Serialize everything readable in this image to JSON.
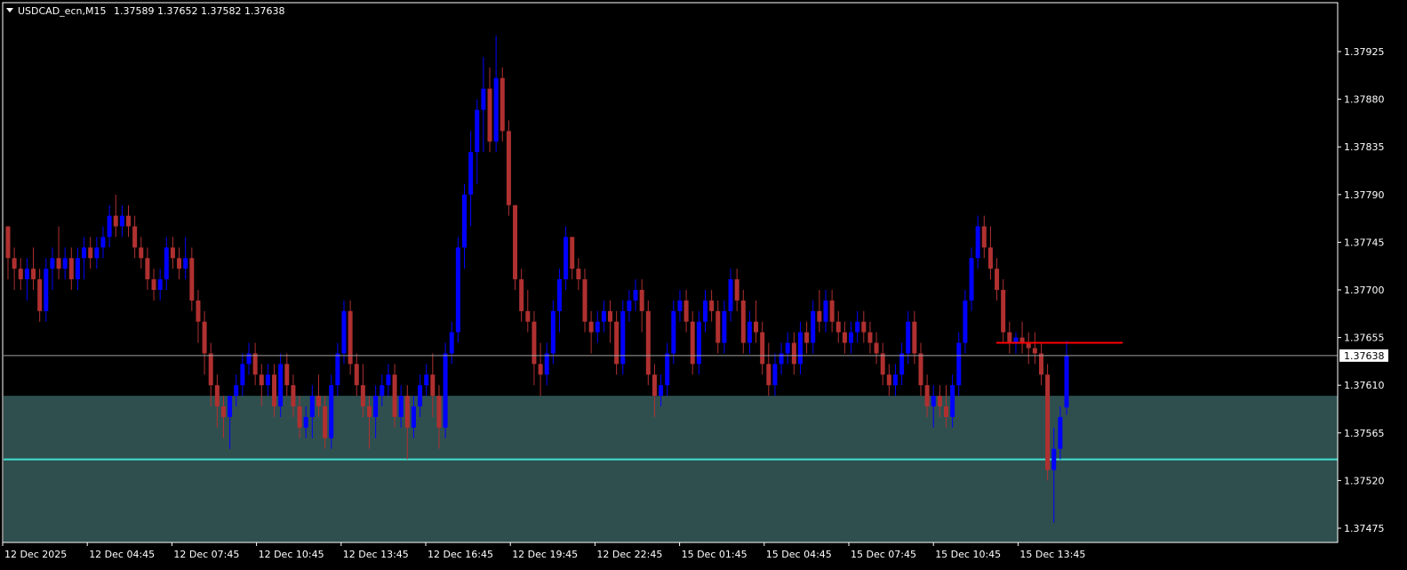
{
  "header": {
    "symbol_info": "USDCAD_ecn,M15",
    "ohlc": "1.37589 1.37652 1.37582 1.37638"
  },
  "colors": {
    "background": "#000000",
    "bull": "#0000FF",
    "bear": "#B03030",
    "grid_frame": "#FFFFFF",
    "zone_fill": "#2F4F4F",
    "zone_line": "#40E0D0",
    "resistance_line": "#FF0000",
    "bid_line": "#A0A0A0"
  },
  "chart_data": {
    "type": "candlestick",
    "y_ticks": [
      "1.37925",
      "1.37880",
      "1.37835",
      "1.37790",
      "1.37745",
      "1.37700",
      "1.37655",
      "1.37610",
      "1.37565",
      "1.37520",
      "1.37475"
    ],
    "ylim": [
      1.37445,
      1.3797
    ],
    "x_ticks": [
      "12 Dec 2025",
      "12 Dec 04:45",
      "12 Dec 07:45",
      "12 Dec 10:45",
      "12 Dec 13:45",
      "12 Dec 16:45",
      "12 Dec 19:45",
      "12 Dec 22:45",
      "15 Dec 01:45",
      "15 Dec 04:45",
      "15 Dec 07:45",
      "15 Dec 10:45",
      "15 Dec 13:45"
    ],
    "current_price": "1.37638",
    "zone": {
      "top": 1.376,
      "bottom": 1.3745
    },
    "zone_line": 1.3754,
    "resistance_line": 1.3765,
    "candles": [
      [
        1.3776,
        1.3776,
        1.3771,
        1.3773
      ],
      [
        1.3773,
        1.3774,
        1.377,
        1.3772
      ],
      [
        1.3772,
        1.3773,
        1.377,
        1.3771
      ],
      [
        1.3771,
        1.3773,
        1.3769,
        1.3772
      ],
      [
        1.3772,
        1.3774,
        1.377,
        1.3771
      ],
      [
        1.3771,
        1.3772,
        1.3767,
        1.3768
      ],
      [
        1.3768,
        1.3773,
        1.3767,
        1.3772
      ],
      [
        1.3772,
        1.3774,
        1.377,
        1.3773
      ],
      [
        1.3773,
        1.3776,
        1.3771,
        1.3772
      ],
      [
        1.3772,
        1.3774,
        1.3771,
        1.3773
      ],
      [
        1.3773,
        1.3774,
        1.377,
        1.3771
      ],
      [
        1.3771,
        1.3774,
        1.377,
        1.3773
      ],
      [
        1.3773,
        1.3775,
        1.3771,
        1.3774
      ],
      [
        1.3774,
        1.3775,
        1.3772,
        1.3773
      ],
      [
        1.3773,
        1.3775,
        1.3772,
        1.3774
      ],
      [
        1.3774,
        1.3776,
        1.3773,
        1.3775
      ],
      [
        1.3775,
        1.3778,
        1.3774,
        1.3777
      ],
      [
        1.3777,
        1.3779,
        1.3775,
        1.3776
      ],
      [
        1.3776,
        1.3778,
        1.3775,
        1.3777
      ],
      [
        1.3777,
        1.3778,
        1.3775,
        1.3776
      ],
      [
        1.3776,
        1.3777,
        1.3773,
        1.3774
      ],
      [
        1.3774,
        1.3775,
        1.3772,
        1.3773
      ],
      [
        1.3773,
        1.3774,
        1.377,
        1.3771
      ],
      [
        1.3771,
        1.3772,
        1.3769,
        1.377
      ],
      [
        1.377,
        1.3772,
        1.3769,
        1.3771
      ],
      [
        1.3771,
        1.3775,
        1.377,
        1.3774
      ],
      [
        1.3774,
        1.3775,
        1.3772,
        1.3773
      ],
      [
        1.3773,
        1.3774,
        1.3771,
        1.3772
      ],
      [
        1.3772,
        1.3775,
        1.3771,
        1.3773
      ],
      [
        1.3773,
        1.3774,
        1.3768,
        1.3769
      ],
      [
        1.3769,
        1.377,
        1.3765,
        1.3767
      ],
      [
        1.3767,
        1.3768,
        1.3762,
        1.3764
      ],
      [
        1.3764,
        1.3765,
        1.3759,
        1.3761
      ],
      [
        1.3761,
        1.3762,
        1.3757,
        1.3759
      ],
      [
        1.3759,
        1.376,
        1.3756,
        1.3758
      ],
      [
        1.3758,
        1.376,
        1.3755,
        1.376
      ],
      [
        1.376,
        1.3762,
        1.3759,
        1.3761
      ],
      [
        1.3761,
        1.3764,
        1.376,
        1.3763
      ],
      [
        1.3763,
        1.3765,
        1.3762,
        1.3764
      ],
      [
        1.3764,
        1.3765,
        1.3761,
        1.3762
      ],
      [
        1.3762,
        1.3763,
        1.3759,
        1.3761
      ],
      [
        1.3761,
        1.3763,
        1.376,
        1.3762
      ],
      [
        1.3762,
        1.3763,
        1.3758,
        1.3759
      ],
      [
        1.3759,
        1.3764,
        1.3758,
        1.3763
      ],
      [
        1.3763,
        1.3764,
        1.376,
        1.3761
      ],
      [
        1.3761,
        1.3762,
        1.3758,
        1.3759
      ],
      [
        1.3759,
        1.376,
        1.3756,
        1.3757
      ],
      [
        1.3757,
        1.3759,
        1.3756,
        1.3758
      ],
      [
        1.3758,
        1.3761,
        1.3756,
        1.376
      ],
      [
        1.376,
        1.3762,
        1.3758,
        1.3759
      ],
      [
        1.3759,
        1.376,
        1.3755,
        1.3756
      ],
      [
        1.3756,
        1.3762,
        1.3755,
        1.3761
      ],
      [
        1.3761,
        1.3765,
        1.376,
        1.3764
      ],
      [
        1.3764,
        1.3769,
        1.3763,
        1.3768
      ],
      [
        1.3768,
        1.3769,
        1.3762,
        1.3763
      ],
      [
        1.3763,
        1.3764,
        1.376,
        1.3761
      ],
      [
        1.3761,
        1.3763,
        1.3758,
        1.3759
      ],
      [
        1.3759,
        1.376,
        1.3755,
        1.3758
      ],
      [
        1.3758,
        1.3761,
        1.3756,
        1.376
      ],
      [
        1.376,
        1.3762,
        1.3759,
        1.3761
      ],
      [
        1.3761,
        1.3763,
        1.376,
        1.3762
      ],
      [
        1.3762,
        1.3763,
        1.3757,
        1.3758
      ],
      [
        1.3758,
        1.3761,
        1.3757,
        1.376
      ],
      [
        1.376,
        1.3761,
        1.3754,
        1.3757
      ],
      [
        1.3757,
        1.376,
        1.3756,
        1.3759
      ],
      [
        1.3759,
        1.3762,
        1.3758,
        1.3761
      ],
      [
        1.3761,
        1.3763,
        1.376,
        1.3762
      ],
      [
        1.3762,
        1.3764,
        1.3758,
        1.376
      ],
      [
        1.376,
        1.3761,
        1.3755,
        1.3757
      ],
      [
        1.3757,
        1.3765,
        1.3756,
        1.3764
      ],
      [
        1.3764,
        1.3767,
        1.3763,
        1.3766
      ],
      [
        1.3766,
        1.3775,
        1.3765,
        1.3774
      ],
      [
        1.3774,
        1.378,
        1.3772,
        1.3779
      ],
      [
        1.3779,
        1.3785,
        1.3776,
        1.3783
      ],
      [
        1.3783,
        1.3788,
        1.378,
        1.3787
      ],
      [
        1.3787,
        1.3792,
        1.3783,
        1.3789
      ],
      [
        1.3789,
        1.3791,
        1.3783,
        1.3784
      ],
      [
        1.3784,
        1.3794,
        1.3783,
        1.379
      ],
      [
        1.379,
        1.3791,
        1.3784,
        1.3785
      ],
      [
        1.3785,
        1.3786,
        1.3777,
        1.3778
      ],
      [
        1.3778,
        1.3778,
        1.377,
        1.3771
      ],
      [
        1.3771,
        1.3772,
        1.3767,
        1.3768
      ],
      [
        1.3768,
        1.377,
        1.3766,
        1.3767
      ],
      [
        1.3767,
        1.3768,
        1.3761,
        1.3763
      ],
      [
        1.3763,
        1.3765,
        1.376,
        1.3762
      ],
      [
        1.3762,
        1.3765,
        1.3761,
        1.3764
      ],
      [
        1.3764,
        1.3769,
        1.3763,
        1.3768
      ],
      [
        1.3768,
        1.3772,
        1.3766,
        1.3771
      ],
      [
        1.3771,
        1.3776,
        1.377,
        1.3775
      ],
      [
        1.3775,
        1.3775,
        1.3771,
        1.3772
      ],
      [
        1.3772,
        1.3773,
        1.377,
        1.3771
      ],
      [
        1.3771,
        1.3772,
        1.3766,
        1.3767
      ],
      [
        1.3767,
        1.3768,
        1.3764,
        1.3766
      ],
      [
        1.3766,
        1.3768,
        1.3765,
        1.3767
      ],
      [
        1.3767,
        1.3769,
        1.3766,
        1.3768
      ],
      [
        1.3768,
        1.3769,
        1.3765,
        1.3767
      ],
      [
        1.3767,
        1.3768,
        1.3762,
        1.3763
      ],
      [
        1.3763,
        1.3769,
        1.3762,
        1.3768
      ],
      [
        1.3768,
        1.377,
        1.3767,
        1.3769
      ],
      [
        1.3769,
        1.3771,
        1.3768,
        1.377
      ],
      [
        1.377,
        1.3771,
        1.3766,
        1.3768
      ],
      [
        1.3768,
        1.3769,
        1.3761,
        1.3762
      ],
      [
        1.3762,
        1.3763,
        1.3758,
        1.376
      ],
      [
        1.376,
        1.3762,
        1.3759,
        1.3761
      ],
      [
        1.3761,
        1.3765,
        1.376,
        1.3764
      ],
      [
        1.3764,
        1.3769,
        1.3763,
        1.3768
      ],
      [
        1.3768,
        1.377,
        1.3767,
        1.3769
      ],
      [
        1.3769,
        1.377,
        1.3766,
        1.3767
      ],
      [
        1.3767,
        1.3768,
        1.3762,
        1.3763
      ],
      [
        1.3763,
        1.3768,
        1.3762,
        1.3767
      ],
      [
        1.3767,
        1.377,
        1.3766,
        1.3769
      ],
      [
        1.3769,
        1.377,
        1.3767,
        1.3768
      ],
      [
        1.3768,
        1.3769,
        1.3764,
        1.3765
      ],
      [
        1.3765,
        1.3769,
        1.3764,
        1.3768
      ],
      [
        1.3768,
        1.3772,
        1.3767,
        1.3771
      ],
      [
        1.3771,
        1.3772,
        1.3768,
        1.3769
      ],
      [
        1.3769,
        1.377,
        1.3764,
        1.3765
      ],
      [
        1.3765,
        1.3768,
        1.3764,
        1.3767
      ],
      [
        1.3767,
        1.3769,
        1.3765,
        1.3766
      ],
      [
        1.3766,
        1.3767,
        1.3762,
        1.3763
      ],
      [
        1.3763,
        1.3765,
        1.376,
        1.3761
      ],
      [
        1.3761,
        1.3764,
        1.376,
        1.3763
      ],
      [
        1.3763,
        1.3765,
        1.3762,
        1.3764
      ],
      [
        1.3764,
        1.3766,
        1.3763,
        1.3765
      ],
      [
        1.3765,
        1.3766,
        1.3762,
        1.3763
      ],
      [
        1.3763,
        1.3767,
        1.3762,
        1.3766
      ],
      [
        1.3766,
        1.3767,
        1.3764,
        1.3765
      ],
      [
        1.3765,
        1.3769,
        1.3764,
        1.3768
      ],
      [
        1.3768,
        1.377,
        1.3766,
        1.3767
      ],
      [
        1.3767,
        1.377,
        1.3766,
        1.3769
      ],
      [
        1.3769,
        1.377,
        1.3766,
        1.3767
      ],
      [
        1.3767,
        1.3768,
        1.3765,
        1.3766
      ],
      [
        1.3766,
        1.3767,
        1.3764,
        1.3765
      ],
      [
        1.3765,
        1.3767,
        1.3764,
        1.3766
      ],
      [
        1.3766,
        1.3768,
        1.3765,
        1.3767
      ],
      [
        1.3767,
        1.3768,
        1.3765,
        1.3766
      ],
      [
        1.3766,
        1.3767,
        1.3764,
        1.3765
      ],
      [
        1.3765,
        1.3766,
        1.3763,
        1.3764
      ],
      [
        1.3764,
        1.3765,
        1.3761,
        1.3762
      ],
      [
        1.3762,
        1.3763,
        1.376,
        1.3761
      ],
      [
        1.3761,
        1.3763,
        1.376,
        1.3762
      ],
      [
        1.3762,
        1.3765,
        1.3761,
        1.3764
      ],
      [
        1.3764,
        1.3768,
        1.3763,
        1.3767
      ],
      [
        1.3767,
        1.3768,
        1.3763,
        1.3764
      ],
      [
        1.3764,
        1.3765,
        1.376,
        1.3761
      ],
      [
        1.3761,
        1.3762,
        1.3758,
        1.3759
      ],
      [
        1.3759,
        1.3761,
        1.3757,
        1.376
      ],
      [
        1.376,
        1.3761,
        1.3758,
        1.3759
      ],
      [
        1.3759,
        1.3761,
        1.3757,
        1.3758
      ],
      [
        1.3758,
        1.3762,
        1.3757,
        1.3761
      ],
      [
        1.3761,
        1.3766,
        1.376,
        1.3765
      ],
      [
        1.3765,
        1.377,
        1.3764,
        1.3769
      ],
      [
        1.3769,
        1.3774,
        1.3768,
        1.3773
      ],
      [
        1.3773,
        1.3777,
        1.3772,
        1.3776
      ],
      [
        1.3776,
        1.3777,
        1.3773,
        1.3774
      ],
      [
        1.3774,
        1.3776,
        1.3771,
        1.3772
      ],
      [
        1.3772,
        1.3773,
        1.3769,
        1.377
      ],
      [
        1.377,
        1.3771,
        1.3765,
        1.3766
      ],
      [
        1.3766,
        1.3767,
        1.3764,
        1.3765
      ],
      [
        1.3765,
        1.3766,
        1.3764,
        1.37655
      ],
      [
        1.37655,
        1.3767,
        1.3764,
        1.3765
      ],
      [
        1.3765,
        1.3766,
        1.3763,
        1.37645
      ],
      [
        1.37645,
        1.3766,
        1.3763,
        1.3764
      ],
      [
        1.3764,
        1.3765,
        1.3761,
        1.3762
      ],
      [
        1.3762,
        1.3763,
        1.3752,
        1.3753
      ],
      [
        1.3753,
        1.3757,
        1.3748,
        1.3755
      ],
      [
        1.3755,
        1.3759,
        1.3754,
        1.3758
      ],
      [
        1.37589,
        1.37652,
        1.37582,
        1.37638
      ]
    ]
  }
}
